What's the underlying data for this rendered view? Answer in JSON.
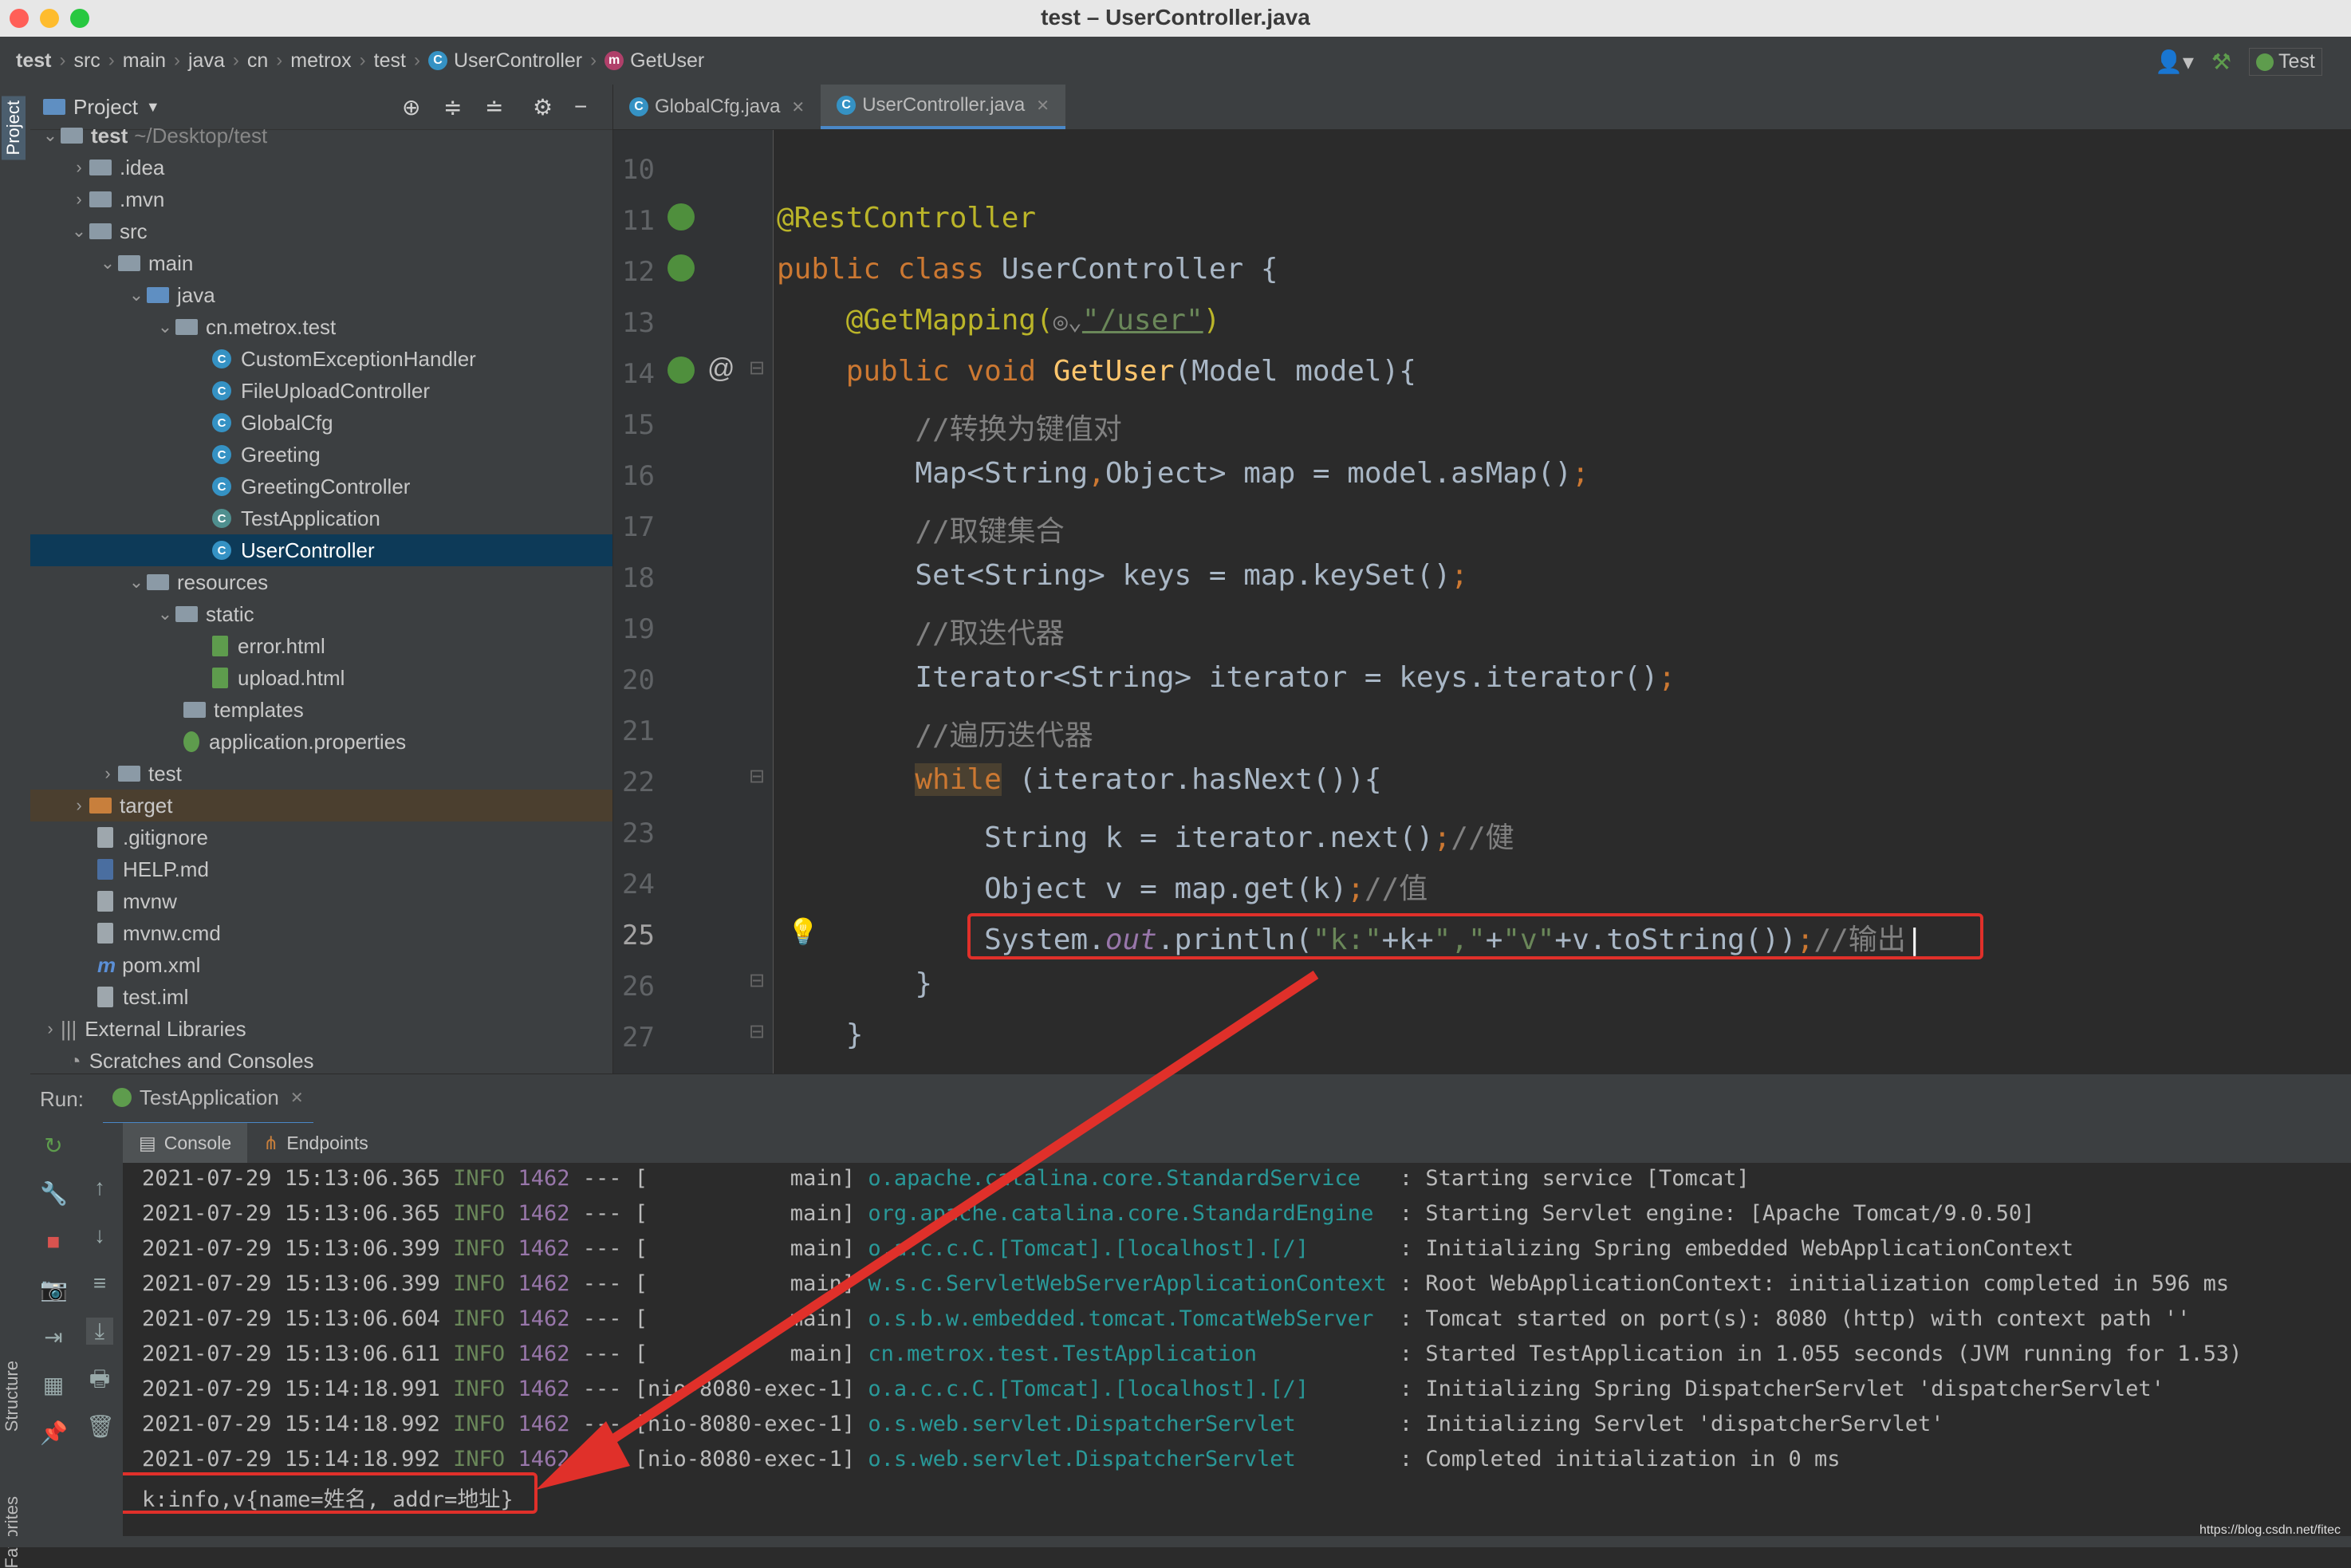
{
  "window": {
    "title": "test – UserController.java"
  },
  "breadcrumbs": [
    "test",
    "src",
    "main",
    "java",
    "cn",
    "metrox",
    "test",
    "UserController",
    "GetUser"
  ],
  "toolbar": {
    "run_config": "Test"
  },
  "sidebar_tabs": {
    "project": "Project",
    "structure": "Structure",
    "favorites": "Favorites"
  },
  "project_panel": {
    "title": "Project",
    "root": {
      "name": "test",
      "path": "~/Desktop/test"
    },
    "items": [
      ".idea",
      ".mvn",
      "src",
      "main",
      "java",
      "cn.metrox.test",
      "CustomExceptionHandler",
      "FileUploadController",
      "GlobalCfg",
      "Greeting",
      "GreetingController",
      "TestApplication",
      "UserController",
      "resources",
      "static",
      "error.html",
      "upload.html",
      "templates",
      "application.properties",
      "test",
      "target",
      ".gitignore",
      "HELP.md",
      "mvnw",
      "mvnw.cmd",
      "pom.xml",
      "test.iml",
      "External Libraries",
      "Scratches and Consoles"
    ]
  },
  "editor": {
    "tabs": [
      "GlobalCfg.java",
      "UserController.java"
    ],
    "active_tab": "UserController.java",
    "line_numbers": [
      "10",
      "11",
      "12",
      "13",
      "14",
      "15",
      "16",
      "17",
      "18",
      "19",
      "20",
      "21",
      "22",
      "23",
      "24",
      "25",
      "26",
      "27"
    ],
    "lines": {
      "l11": "@RestController",
      "l12a": "public class ",
      "l12b": "UserController {",
      "l13a": "    @GetMapping(",
      "l13b": "\"/user\"",
      "l13c": ")",
      "l14a": "    public void ",
      "l14b": "GetUser",
      "l14c": "(Model model){",
      "l15": "        //转换为键值对",
      "l16a": "        Map<String",
      "l16b": ",",
      "l16c": "Object> map = model.asMap()",
      "l16d": ";",
      "l17": "        //取键集合",
      "l18a": "        Set<String> keys = map.keySet()",
      "l18b": ";",
      "l19": "        //取迭代器",
      "l20a": "        Iterator<String> iterator = keys.iterator()",
      "l20b": ";",
      "l21": "        //遍历迭代器",
      "l22a": "        ",
      "l22b": "while",
      "l22c": " (iterator.hasNext()){",
      "l23a": "            String k = iterator.next()",
      "l23b": ";",
      "l23c": "//健",
      "l24a": "            Object v = map.get(k)",
      "l24b": ";",
      "l24c": "//值",
      "l25a": "            System.",
      "l25b": "out",
      "l25c": ".println(",
      "l25d": "\"k:\"",
      "l25e": "+k+",
      "l25f": "\",\"",
      "l25g": "+",
      "l25h": "\"v\"",
      "l25i": "+v.toString())",
      "l25j": ";",
      "l25k": "//输出",
      "l26": "        }",
      "l27": "    }"
    }
  },
  "run": {
    "label": "Run:",
    "config": "TestApplication",
    "tabs": [
      "Console",
      "Endpoints"
    ],
    "logs": [
      {
        "ts": "2021-07-29 15:13:06.365",
        "lvl": "INFO",
        "pid": "1462",
        "thread": " --- [           main]",
        "logger": "o.apache.catalina.core.StandardService  ",
        "msg": " : Starting service [Tomcat]"
      },
      {
        "ts": "2021-07-29 15:13:06.365",
        "lvl": "INFO",
        "pid": "1462",
        "thread": " --- [           main]",
        "logger": "org.apache.catalina.core.StandardEngine ",
        "msg": " : Starting Servlet engine: [Apache Tomcat/9.0.50]"
      },
      {
        "ts": "2021-07-29 15:13:06.399",
        "lvl": "INFO",
        "pid": "1462",
        "thread": " --- [           main]",
        "logger": "o.a.c.c.C.[Tomcat].[localhost].[/]      ",
        "msg": " : Initializing Spring embedded WebApplicationContext"
      },
      {
        "ts": "2021-07-29 15:13:06.399",
        "lvl": "INFO",
        "pid": "1462",
        "thread": " --- [           main]",
        "logger": "w.s.c.ServletWebServerApplicationContext",
        "msg": " : Root WebApplicationContext: initialization completed in 596 ms"
      },
      {
        "ts": "2021-07-29 15:13:06.604",
        "lvl": "INFO",
        "pid": "1462",
        "thread": " --- [           main]",
        "logger": "o.s.b.w.embedded.tomcat.TomcatWebServer ",
        "msg": " : Tomcat started on port(s): 8080 (http) with context path ''"
      },
      {
        "ts": "2021-07-29 15:13:06.611",
        "lvl": "INFO",
        "pid": "1462",
        "thread": " --- [           main]",
        "logger": "cn.metrox.test.TestApplication          ",
        "msg": " : Started TestApplication in 1.055 seconds (JVM running for 1.53)"
      },
      {
        "ts": "2021-07-29 15:14:18.991",
        "lvl": "INFO",
        "pid": "1462",
        "thread": " --- [nio-8080-exec-1]",
        "logger": "o.a.c.c.C.[Tomcat].[localhost].[/]      ",
        "msg": " : Initializing Spring DispatcherServlet 'dispatcherServlet'"
      },
      {
        "ts": "2021-07-29 15:14:18.992",
        "lvl": "INFO",
        "pid": "1462",
        "thread": " --- [nio-8080-exec-1]",
        "logger": "o.s.web.servlet.DispatcherServlet       ",
        "msg": " : Initializing Servlet 'dispatcherServlet'"
      },
      {
        "ts": "2021-07-29 15:14:18.992",
        "lvl": "INFO",
        "pid": "1462",
        "thread": " --- [nio-8080-exec-1]",
        "logger": "o.s.web.servlet.DispatcherServlet       ",
        "msg": " : Completed initialization in 0 ms"
      }
    ],
    "output": "k:info,v{name=姓名, addr=地址}"
  },
  "watermark": "https://blog.csdn.net/fitec",
  "colors": {
    "accent": "#4a88c7",
    "highlight_box": "#e0302a",
    "selection": "#0d3a58"
  }
}
